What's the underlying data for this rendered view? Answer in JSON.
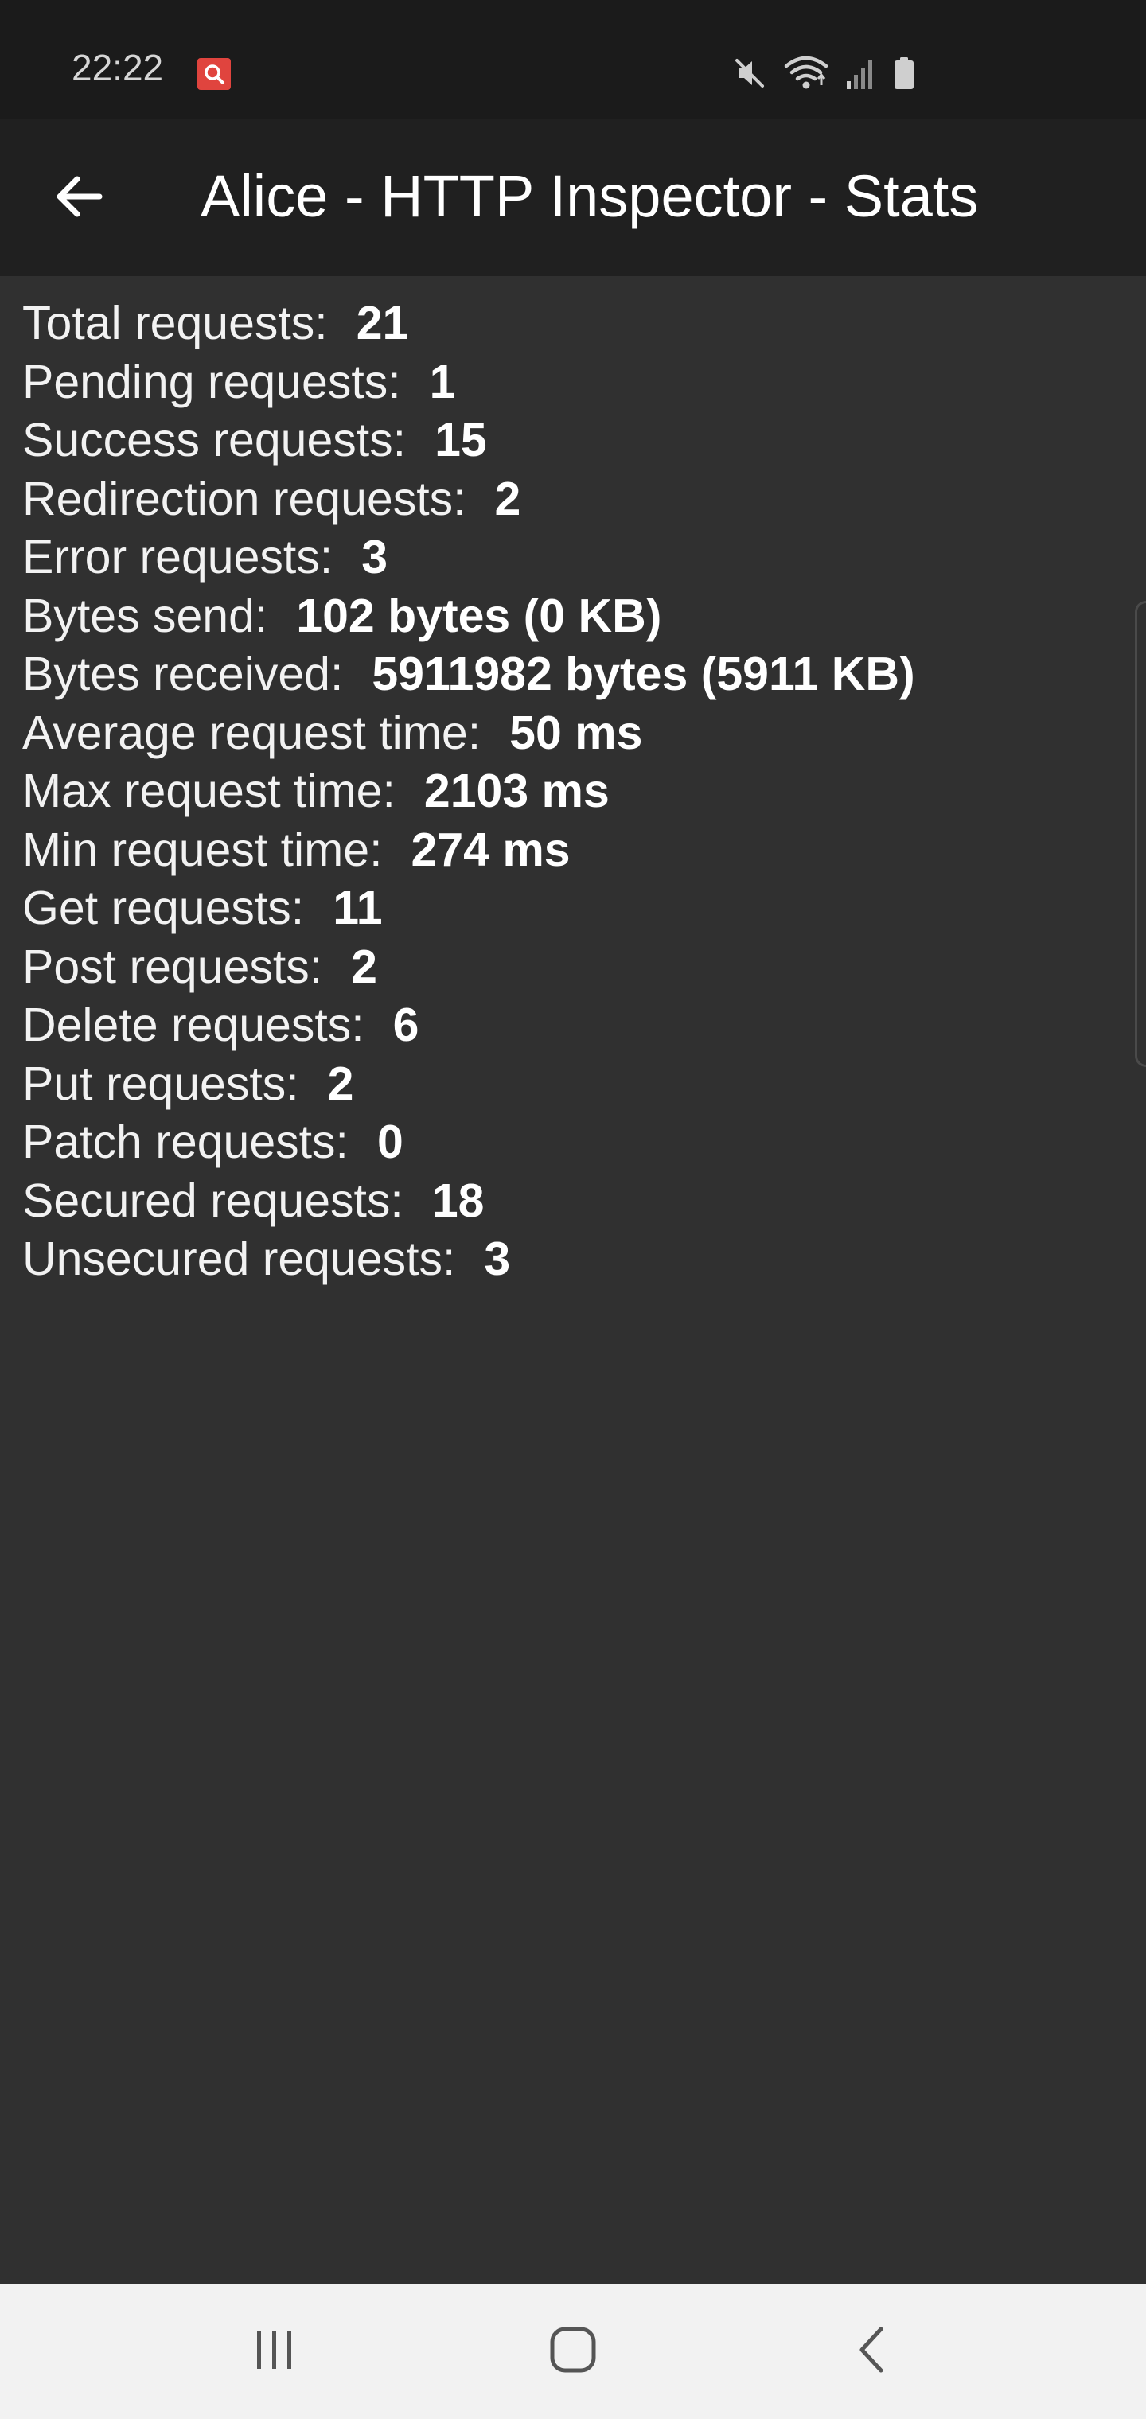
{
  "status_bar": {
    "time": "22:22",
    "icons": [
      "notification-app-icon",
      "mute-icon",
      "wifi-icon",
      "signal-icon",
      "battery-icon"
    ]
  },
  "app_bar": {
    "title": "Alice - HTTP Inspector - Stats",
    "back_icon": "arrow-left-icon"
  },
  "stats": [
    {
      "label": "Total requests:",
      "value": "21"
    },
    {
      "label": "Pending requests:",
      "value": "1"
    },
    {
      "label": "Success requests:",
      "value": "15"
    },
    {
      "label": "Redirection requests:",
      "value": "2"
    },
    {
      "label": "Error requests:",
      "value": "3"
    },
    {
      "label": "Bytes send:",
      "value": "102 bytes (0 KB)"
    },
    {
      "label": "Bytes received:",
      "value": "5911982 bytes (5911 KB)"
    },
    {
      "label": "Average request time:",
      "value": "50 ms"
    },
    {
      "label": "Max request time:",
      "value": "2103 ms"
    },
    {
      "label": "Min request time:",
      "value": "274 ms"
    },
    {
      "label": "Get requests:",
      "value": "11"
    },
    {
      "label": "Post requests:",
      "value": "2"
    },
    {
      "label": "Delete requests:",
      "value": "6"
    },
    {
      "label": "Put requests:",
      "value": "2"
    },
    {
      "label": "Patch requests:",
      "value": "0"
    },
    {
      "label": "Secured requests:",
      "value": "18"
    },
    {
      "label": "Unsecured requests:",
      "value": "3"
    }
  ],
  "nav_bar": {
    "buttons": [
      "recent-apps-icon",
      "home-icon",
      "back-icon"
    ]
  },
  "colors": {
    "background": "#303030",
    "app_bar": "#202020",
    "status_bar": "#1b1b1b",
    "nav_bar": "#f2f2f2",
    "notification_badge": "#e0443e"
  }
}
